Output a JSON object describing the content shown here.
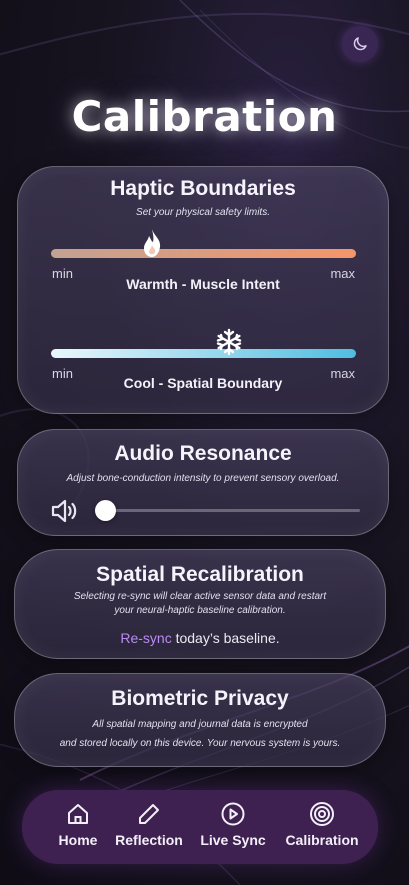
{
  "header": {
    "title": "Calibration",
    "theme_toggle_icon": "moon-icon"
  },
  "haptic": {
    "title": "Haptic Boundaries",
    "subtitle": "Set your physical safety limits.",
    "warmth": {
      "label": "Warmth - Muscle Intent",
      "min": "min",
      "max": "max",
      "value_pct": 33,
      "icon": "flame-icon",
      "colors": [
        "#c9a08f",
        "#f5966a"
      ]
    },
    "cool": {
      "label": "Cool - Spatial Boundary",
      "min": "min",
      "max": "max",
      "value_pct": 58,
      "icon": "snowflake-icon",
      "colors": [
        "#e9f6fb",
        "#4fbddf"
      ]
    }
  },
  "audio": {
    "title": "Audio Resonance",
    "subtitle": "Adjust bone-conduction intensity to prevent sensory overload.",
    "volume_icon": "speaker-icon",
    "value_pct": 0
  },
  "spatial": {
    "title": "Spatial Recalibration",
    "subtitle_line1": "Selecting re-sync will clear active sensor data and restart",
    "subtitle_line2": "your neural-haptic baseline calibration.",
    "link_text": "Re-sync",
    "rest_text": " today’s baseline."
  },
  "privacy": {
    "title": "Biometric Privacy",
    "line1": "All spatial mapping and journal data is encrypted",
    "line2": "and stored locally on this device. Your nervous system is yours."
  },
  "nav": {
    "items": [
      {
        "label": "Home",
        "icon": "home-icon"
      },
      {
        "label": "Reflection",
        "icon": "pencil-icon"
      },
      {
        "label": "Live Sync",
        "icon": "play-circle-icon"
      },
      {
        "label": "Calibration",
        "icon": "target-icon",
        "active": true
      }
    ]
  },
  "colors": {
    "accent": "#b88cf0",
    "nav_bg": "#3e2150"
  }
}
